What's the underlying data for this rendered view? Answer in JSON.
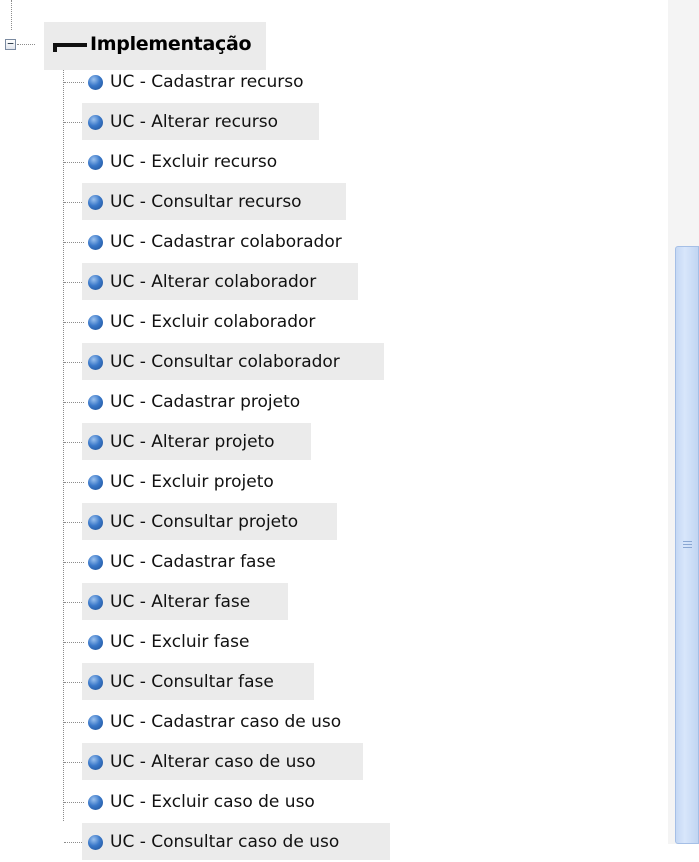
{
  "tree": {
    "root": {
      "label": "Implementação",
      "expander_symbol": "−",
      "expanded": true
    },
    "items": [
      {
        "label": "UC - Cadastrar recurso"
      },
      {
        "label": "UC - Alterar recurso"
      },
      {
        "label": "UC - Excluir recurso"
      },
      {
        "label": "UC - Consultar recurso"
      },
      {
        "label": "UC - Cadastrar colaborador"
      },
      {
        "label": "UC - Alterar colaborador"
      },
      {
        "label": "UC - Excluir colaborador"
      },
      {
        "label": "UC - Consultar colaborador"
      },
      {
        "label": "UC - Cadastrar projeto"
      },
      {
        "label": "UC - Alterar projeto"
      },
      {
        "label": "UC - Excluir projeto"
      },
      {
        "label": "UC - Consultar projeto"
      },
      {
        "label": "UC - Cadastrar fase"
      },
      {
        "label": "UC - Alterar fase"
      },
      {
        "label": "UC - Excluir fase"
      },
      {
        "label": "UC - Consultar fase"
      },
      {
        "label": "UC - Cadastrar caso de uso"
      },
      {
        "label": "UC - Alterar caso de uso"
      },
      {
        "label": "UC - Excluir caso de uso"
      },
      {
        "label": "UC - Consultar caso de uso"
      }
    ],
    "item_icon": "blue-sphere-icon",
    "root_icon": "black-bar-icon"
  },
  "colors": {
    "stripe_background": "#ebebeb",
    "sphere_blue": "#3a78c9",
    "scrollbar_thumb": "#c5d8f4",
    "right_pane": "#f4f4f4"
  }
}
